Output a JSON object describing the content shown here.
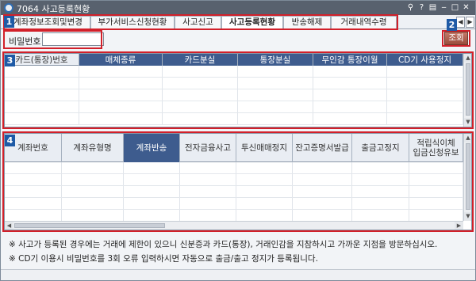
{
  "window": {
    "title": "7064 사고등록현황",
    "controls": [
      "⚲",
      "?",
      "▤",
      "‒",
      "□",
      "✕"
    ]
  },
  "tabs": [
    {
      "label": "계좌정보조회및변경",
      "active": false
    },
    {
      "label": "부가서비스신청현황",
      "active": false
    },
    {
      "label": "사고신고",
      "active": false
    },
    {
      "label": "사고등록현황",
      "active": true
    },
    {
      "label": "반송해제",
      "active": false
    },
    {
      "label": "거래내역수령",
      "active": false
    }
  ],
  "tab_nav": {
    "prev": "◀",
    "next": "▶"
  },
  "password": {
    "label": "비밀번호",
    "value": ""
  },
  "search_button": {
    "label": "조회"
  },
  "badges": {
    "b1": "1",
    "b2": "2",
    "b3": "3",
    "b4": "4"
  },
  "top_grid": {
    "columns": [
      {
        "label": "카드(통장)번호",
        "highlight": false
      },
      {
        "label": "매체종류",
        "highlight": true
      },
      {
        "label": "카드분실",
        "highlight": true
      },
      {
        "label": "통장분실",
        "highlight": true
      },
      {
        "label": "무인감 통장이월",
        "highlight": true
      },
      {
        "label": "CD기 사용정지",
        "highlight": true
      }
    ]
  },
  "bottom_grid": {
    "columns": [
      {
        "label": "계좌번호",
        "highlight": false
      },
      {
        "label": "계좌유형명",
        "highlight": false
      },
      {
        "label": "계좌반송",
        "highlight": true
      },
      {
        "label": "전자금융사고",
        "highlight": false
      },
      {
        "label": "투신매매정지",
        "highlight": false
      },
      {
        "label": "잔고증명서발급",
        "highlight": false
      },
      {
        "label": "출금고정지",
        "highlight": false
      },
      {
        "label": "적립식이체\n입금신청유보",
        "highlight": false
      }
    ]
  },
  "notes": [
    "※ 사고가 등록된 경우에는 거래에 제한이 있으니 신분증과 카드(통장), 거래인감을 지참하시고 가까운 지점을 방문하십시오.",
    "※ CD기 이용시 비밀번호를 3회 오류 입력하시면 자동으로 출금/출고 정지가 등록됩니다."
  ],
  "colors": {
    "highlight_box": "#d2202a",
    "badge": "#1e5aa6",
    "header_highlight": "#3e5c8e",
    "search_button": "#a85544"
  }
}
